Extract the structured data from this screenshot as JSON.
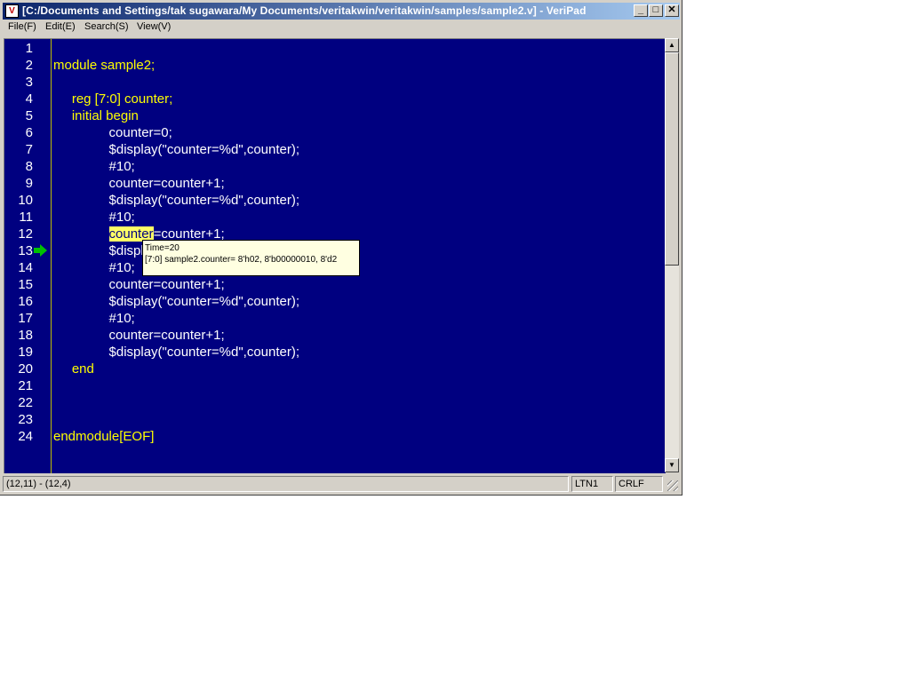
{
  "window": {
    "title": "[C:/Documents and Settings/tak sugawara/My Documents/veritakwin/veritakwin/samples/sample2.v] - VeriPad",
    "buttons": {
      "minimize": "_",
      "maximize": "□",
      "close": "✕"
    }
  },
  "menu": [
    "File(F)",
    "Edit(E)",
    "Search(S)",
    "View(V)"
  ],
  "lines": [
    {
      "n": "1",
      "text": "",
      "kw": false
    },
    {
      "n": "2",
      "text": "module sample2;",
      "kw": true
    },
    {
      "n": "3",
      "text": "",
      "kw": false
    },
    {
      "n": "4",
      "text": "     reg [7:0] counter;",
      "kw": true
    },
    {
      "n": "5",
      "text": "     initial begin",
      "kw": true
    },
    {
      "n": "6",
      "text": "               counter=0;",
      "kw": false
    },
    {
      "n": "7",
      "text": "               $display(\"counter=%d\",counter);",
      "kw": false
    },
    {
      "n": "8",
      "text": "               #10;",
      "kw": false
    },
    {
      "n": "9",
      "text": "               counter=counter+1;",
      "kw": false
    },
    {
      "n": "10",
      "text": "               $display(\"counter=%d\",counter);",
      "kw": false
    },
    {
      "n": "11",
      "text": "               #10;",
      "kw": false
    },
    {
      "n": "12",
      "text": "               counter=counter+1;",
      "kw": false
    },
    {
      "n": "13",
      "text": "               $display(\"counter=%d\",counter);",
      "kw": false
    },
    {
      "n": "14",
      "text": "               #10;",
      "kw": false
    },
    {
      "n": "15",
      "text": "               counter=counter+1;",
      "kw": false
    },
    {
      "n": "16",
      "text": "               $display(\"counter=%d\",counter);",
      "kw": false
    },
    {
      "n": "17",
      "text": "               #10;",
      "kw": false
    },
    {
      "n": "18",
      "text": "               counter=counter+1;",
      "kw": false
    },
    {
      "n": "19",
      "text": "               $display(\"counter=%d\",counter);",
      "kw": false
    },
    {
      "n": "20",
      "text": "     end",
      "kw": true
    },
    {
      "n": "21",
      "text": "",
      "kw": false
    },
    {
      "n": "22",
      "text": "",
      "kw": false
    },
    {
      "n": "23",
      "text": "",
      "kw": false
    },
    {
      "n": "24",
      "text": "endmodule[EOF]",
      "kw": true
    }
  ],
  "highlight": {
    "line": "12",
    "word": "counter",
    "rest": "=counter+1;"
  },
  "current_line": "13",
  "tooltip": {
    "line1": "Time=20",
    "line2": "[7:0] sample2.counter= 8'h02, 8'b00000010, 8'd2"
  },
  "status": {
    "position": "(12,11) - (12,4)",
    "encoding": "LTN1",
    "line_ending": "CRLF"
  },
  "colors": {
    "editor_bg": "#000080",
    "keyword": "#ffff00",
    "text": "#ffffff",
    "highlight": "#ffff66",
    "arrow": "#00c000"
  }
}
